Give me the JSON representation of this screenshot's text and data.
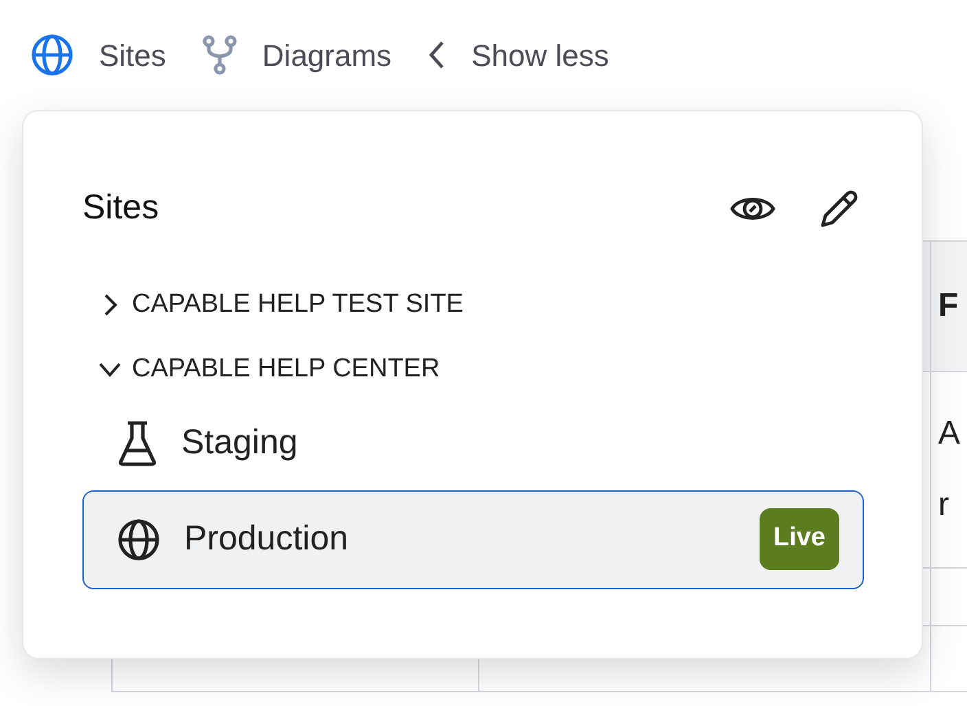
{
  "nav": [
    {
      "label": "Sites",
      "kind": "globe",
      "selected": true
    },
    {
      "label": "Diagrams",
      "kind": "branch",
      "selected": false
    },
    {
      "label": "Show less",
      "kind": "back",
      "selected": false
    }
  ],
  "popover": {
    "title": "Sites",
    "sites": [
      {
        "label": "CAPABLE HELP TEST SITE",
        "expanded": false
      },
      {
        "label": "CAPABLE HELP CENTER",
        "expanded": true,
        "children": [
          {
            "label": "Staging",
            "kind": "flask",
            "selected": false
          },
          {
            "label": "Production",
            "kind": "globe",
            "selected": true,
            "badge": "Live"
          }
        ]
      }
    ]
  },
  "table": {
    "header": [
      "F"
    ],
    "cell_lines": [
      "A",
      "r"
    ]
  }
}
